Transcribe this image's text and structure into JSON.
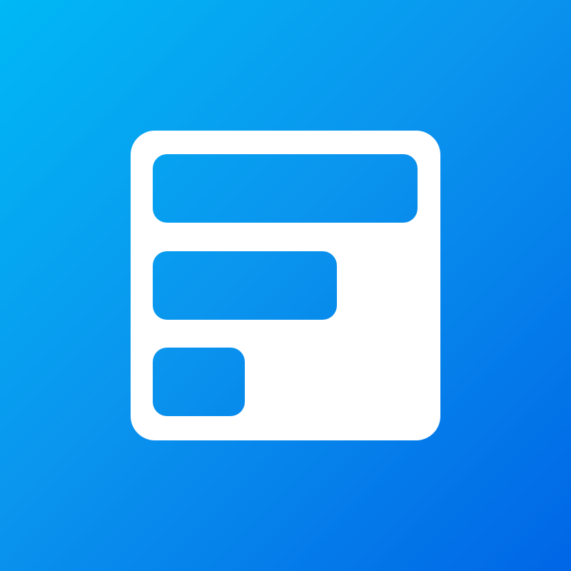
{
  "icon": {
    "name": "layout-list-icon",
    "background_gradient": [
      "#00b8f5",
      "#0a95ee",
      "#0066e6"
    ],
    "foreground_color": "#ffffff"
  }
}
